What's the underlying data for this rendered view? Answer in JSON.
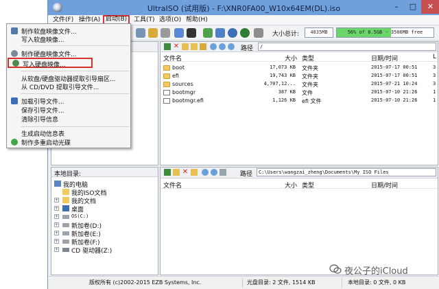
{
  "window": {
    "title": "UltraISO (试用版) - F:\\XNR0FA00_W10x64EM(DL).iso",
    "minimize": "–",
    "maximize": "□",
    "close": "✕"
  },
  "menu": {
    "items": [
      {
        "label": "文件(F)"
      },
      {
        "label": "操作(A)"
      },
      {
        "label": "启动(B)"
      },
      {
        "label": "工具(T)"
      },
      {
        "label": "选项(O)"
      },
      {
        "label": "帮助(H)"
      }
    ]
  },
  "toolbar": {
    "size_label": "大小总计:",
    "size_value": "4835MB",
    "capacity_text": "56% of 8.5GB - 3506MB free",
    "capacity_fraction": 0.56
  },
  "boot_menu": {
    "items": [
      {
        "label": "制作软盘映像文件...",
        "icon": "floppy-image-icon"
      },
      {
        "label": "写入软盘映像...",
        "icon": ""
      },
      {
        "label": "制作硬盘映像文件...",
        "icon": "disk-image-icon"
      },
      {
        "label": "写入硬盘映像...",
        "icon": "write-disk-image-icon"
      },
      {
        "label": "从软盘/硬盘驱动器提取引导扇区...",
        "icon": ""
      },
      {
        "label": "从 CD/DVD 提取引导文件...",
        "icon": ""
      },
      {
        "label": "加载引导文件...",
        "icon": "load-boot-icon"
      },
      {
        "label": "保存引导文件...",
        "icon": ""
      },
      {
        "label": "清除引导信息",
        "icon": ""
      },
      {
        "label": "生成启动信息表",
        "icon": ""
      },
      {
        "label": "制作多重启动光碟",
        "icon": "multiboot-disc-icon"
      }
    ]
  },
  "iso_pane": {
    "path_label": "路径",
    "path_value": "/",
    "columns": {
      "name": "文件名",
      "size": "大小",
      "type": "类型",
      "date": "日期/时间",
      "extra": "L"
    },
    "rows": [
      {
        "name": "boot",
        "size": "17,073 KB",
        "type": "文件夹",
        "date": "2015-07-17 00:51",
        "extra": "3",
        "kind": "folder"
      },
      {
        "name": "efi",
        "size": "19,743 KB",
        "type": "文件夹",
        "date": "2015-07-17 00:51",
        "extra": "3",
        "kind": "folder"
      },
      {
        "name": "sources",
        "size": "4,707,12...",
        "type": "文件夹",
        "date": "2015-07-21 10:24",
        "extra": "3",
        "kind": "folder"
      },
      {
        "name": "bootmgr",
        "size": "387 KB",
        "type": "文件",
        "date": "2015-07-10 21:26",
        "extra": "1",
        "kind": "file"
      },
      {
        "name": "bootmgr.efi",
        "size": "1,126 KB",
        "type": "efi 文件",
        "date": "2015-07-10 21:26",
        "extra": "1",
        "kind": "file"
      }
    ]
  },
  "local_pane": {
    "header": "本地目录:",
    "path_label": "路径",
    "path_value": "C:\\Users\\wangzai_zheng\\Documents\\My ISO Files",
    "columns": {
      "name": "文件名",
      "size": "大小",
      "type": "类型",
      "date": "日期/时间"
    },
    "tree": [
      {
        "label": "我的电脑",
        "icon": "computer-icon",
        "level": 0,
        "expander": ""
      },
      {
        "label": "我的ISO文档",
        "icon": "folder-icon",
        "level": 1,
        "expander": ""
      },
      {
        "label": "我的文档",
        "icon": "folder-icon",
        "level": 1,
        "expander": "+"
      },
      {
        "label": "桌面",
        "icon": "desktop-icon",
        "level": 1,
        "expander": "+"
      },
      {
        "label": "OS(C:)",
        "icon": "drive-icon",
        "level": 1,
        "expander": "+"
      },
      {
        "label": "新加卷(D:)",
        "icon": "drive-icon",
        "level": 1,
        "expander": "+"
      },
      {
        "label": "新加卷(E:)",
        "icon": "drive-icon",
        "level": 1,
        "expander": "+"
      },
      {
        "label": "新加卷(F:)",
        "icon": "drive-icon",
        "level": 1,
        "expander": "+"
      },
      {
        "label": "CD 驱动器(Z:)",
        "icon": "cd-drive-icon",
        "level": 1,
        "expander": "+"
      }
    ]
  },
  "status": {
    "copyright": "版权所有 (c)2002-2015 EZB Systems, Inc.",
    "disc_dir": "光盘目录: 2 文件, 1514 KB",
    "local_dir": "本地目录: 0 文件, 0 KB"
  },
  "watermark": {
    "text": "夜公子的iCloud"
  },
  "colors": {
    "titlebar": "#6fa0dc",
    "close_button": "#c75050",
    "highlight_border": "#d9302a",
    "capacity_fill": "#6ad66a",
    "folder": "#f2cb5d"
  }
}
